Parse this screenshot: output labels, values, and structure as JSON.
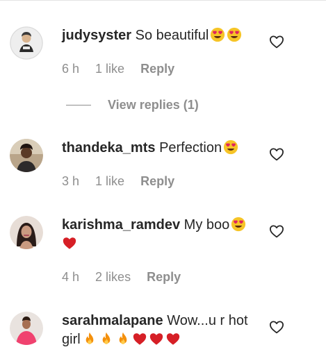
{
  "comments": [
    {
      "username": "judysyster",
      "text": "So beautiful",
      "emojis": [
        "heart-eyes",
        "heart-eyes"
      ],
      "time": "6 h",
      "likes": "1 like",
      "reply_label": "Reply"
    },
    {
      "username": "thandeka_mts",
      "text": "Perfection",
      "emojis": [
        "heart-eyes"
      ],
      "time": "3 h",
      "likes": "1 like",
      "reply_label": "Reply"
    },
    {
      "username": "karishma_ramdev",
      "text": "My boo",
      "emojis": [
        "heart-eyes",
        "red-heart"
      ],
      "time": "4 h",
      "likes": "2 likes",
      "reply_label": "Reply"
    },
    {
      "username": "sarahmalapane",
      "text": "Wow...u r hot girl",
      "emojis": [
        "fire",
        "fire",
        "fire",
        "red-heart",
        "red-heart",
        "red-heart"
      ]
    }
  ],
  "view_replies_label": "View replies (1)",
  "colors": {
    "text": "#262626",
    "muted": "#8e8e8e",
    "heart_red": "#d61f26",
    "emoji_yellow": "#f6c427"
  },
  "icons": [
    "like-heart-outline-icon",
    "heart-eyes-emoji",
    "red-heart-emoji",
    "fire-emoji"
  ]
}
